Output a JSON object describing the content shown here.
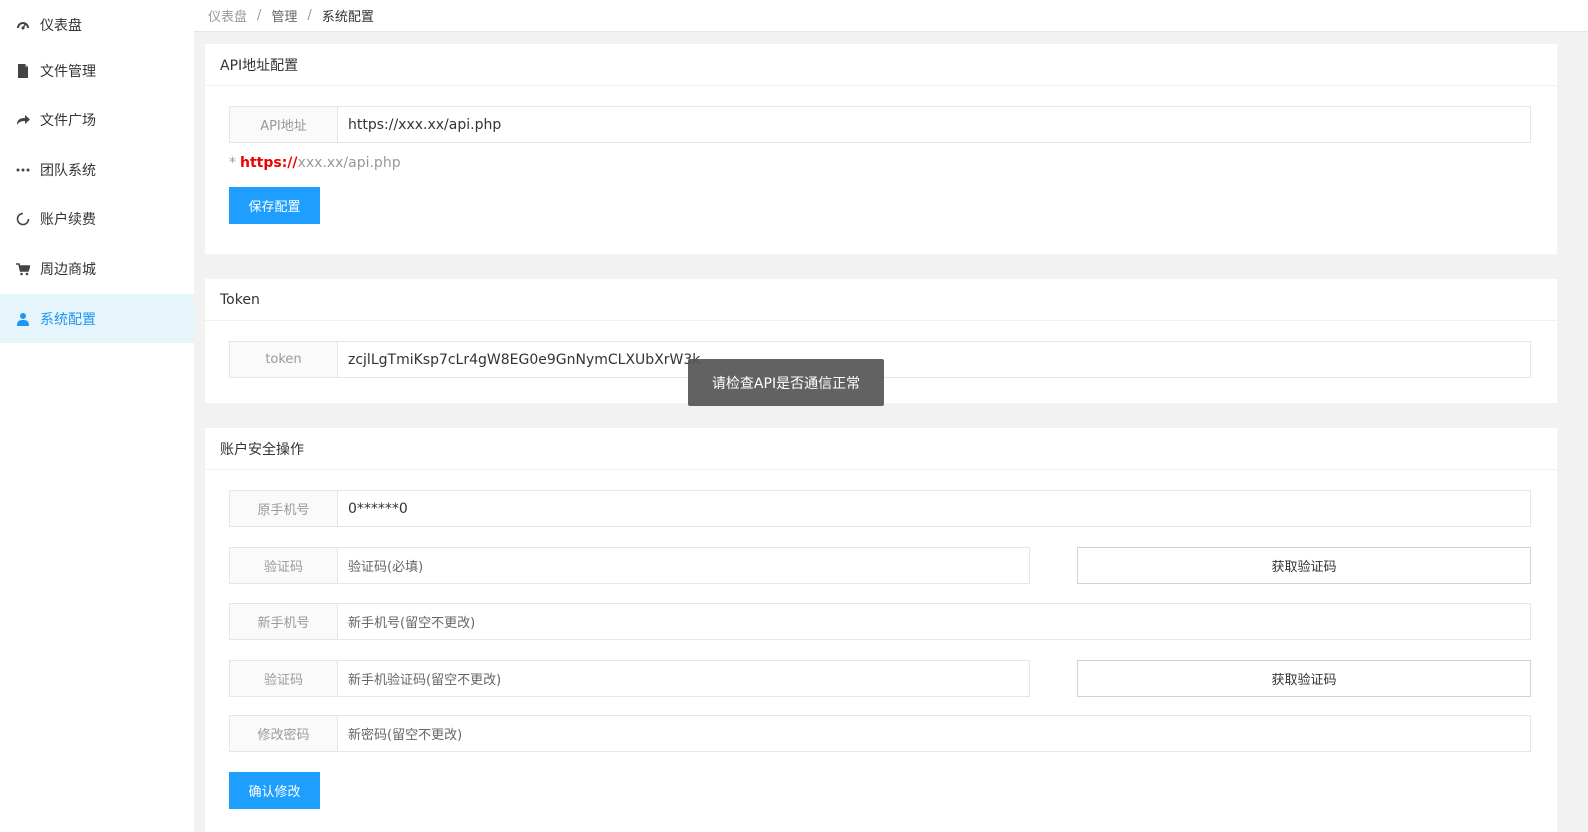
{
  "sidebar": {
    "items": [
      {
        "label": "仪表盘",
        "icon": "dashboard-icon"
      },
      {
        "label": "文件管理",
        "icon": "file-icon"
      },
      {
        "label": "文件广场",
        "icon": "share-icon"
      },
      {
        "label": "团队系统",
        "icon": "ellipsis-icon"
      },
      {
        "label": "账户续费",
        "icon": "refresh-icon"
      },
      {
        "label": "周边商城",
        "icon": "cart-icon"
      },
      {
        "label": "系统配置",
        "icon": "user-icon"
      }
    ],
    "active_color": "#2095f2"
  },
  "breadcrumb": {
    "home": "仪表盘",
    "sep1": "/",
    "mid": "管理",
    "sep2": "/",
    "current": "系统配置"
  },
  "api_card": {
    "title": "API地址配置",
    "field_label": "API地址",
    "field_value": "https://xxx.xx/api.php",
    "hint_star": "*",
    "hint_proto": "https://",
    "hint_rest": "xxx.xx/api.php",
    "save_label": "保存配置"
  },
  "token_card": {
    "title": "Token",
    "field_label": "token",
    "field_value": "zcjlLgTmiKsp7cLr4gW8EG0e9GnNymCLXUbXrW3k"
  },
  "security_card": {
    "title": "账户安全操作",
    "old_phone_label": "原手机号",
    "old_phone_value": "0******0",
    "code_label": "验证码",
    "code_placeholder": "验证码(必填)",
    "get_code_label": "获取验证码",
    "new_phone_label": "新手机号",
    "new_phone_placeholder": "新手机号(留空不更改)",
    "new_code_label": "验证码",
    "new_code_placeholder": "新手机验证码(留空不更改)",
    "get_code_label2": "获取验证码",
    "password_label": "修改密码",
    "password_placeholder": "新密码(留空不更改)",
    "confirm_label": "确认修改"
  },
  "toast": {
    "message": "请检查API是否通信正常"
  },
  "colors": {
    "primary": "#1e9fff",
    "hint_red": "#e00000"
  }
}
